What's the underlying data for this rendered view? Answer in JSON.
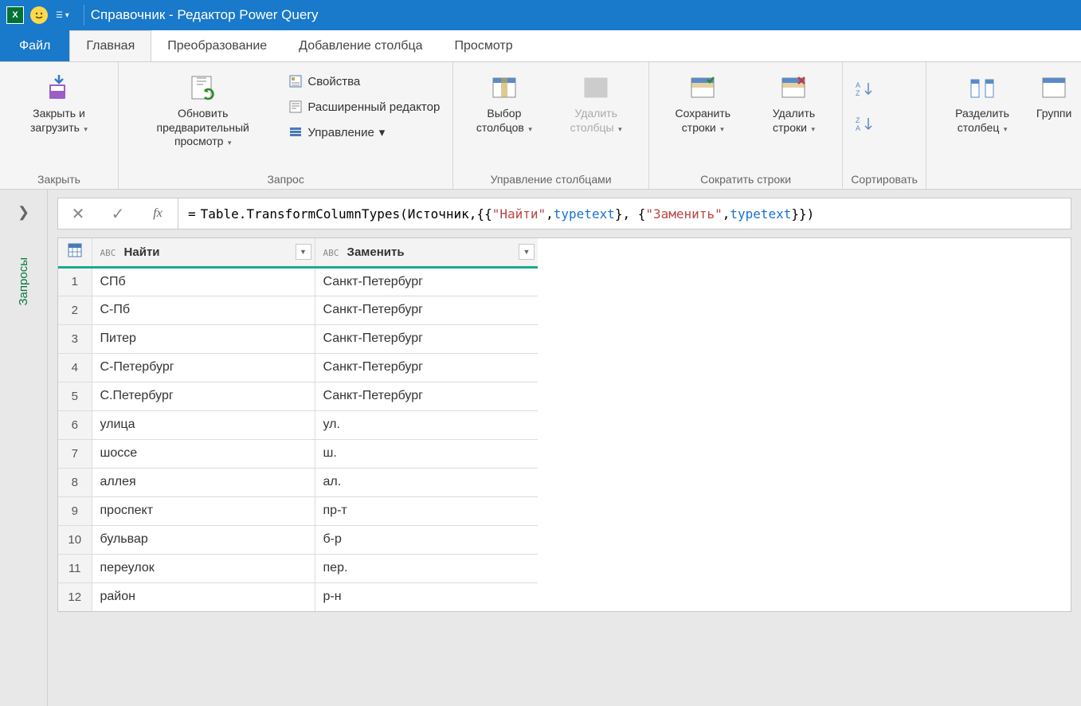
{
  "titlebar": {
    "title": "Справочник - Редактор Power Query"
  },
  "tabs": {
    "file": "Файл",
    "home": "Главная",
    "transform": "Преобразование",
    "addcolumn": "Добавление столбца",
    "view": "Просмотр"
  },
  "ribbon": {
    "close_group": "Закрыть",
    "close_load": "Закрыть и загрузить",
    "query_group": "Запрос",
    "refresh_preview": "Обновить предварительный просмотр",
    "properties": "Свойства",
    "adv_editor": "Расширенный редактор",
    "manage": "Управление",
    "manage_cols_group": "Управление столбцами",
    "choose_cols": "Выбор столбцов",
    "remove_cols": "Удалить столбцы",
    "reduce_rows_group": "Сократить строки",
    "keep_rows": "Сохранить строки",
    "remove_rows": "Удалить строки",
    "sort_group": "Сортировать",
    "split_col": "Разделить столбец",
    "group_by": "Группи"
  },
  "formula": {
    "prefix": "= ",
    "fn": "Table.TransformColumnTypes",
    "open": "(",
    "arg1": "Источник",
    "comma1": ",{{",
    "str1": "\"Найти\"",
    "comma2": ", ",
    "kw1": "type",
    "sp1": " ",
    "kw2": "text",
    "mid": "}, {",
    "str2": "\"Заменить\"",
    "comma3": ", ",
    "kw3": "type",
    "sp2": " ",
    "kw4": "text",
    "end": "}})"
  },
  "queries_label": "Запросы",
  "table": {
    "col1_type": "ABC",
    "col1_name": "Найти",
    "col2_type": "ABC",
    "col2_name": "Заменить",
    "rows": [
      {
        "n": "1",
        "a": "СПб",
        "b": "Санкт-Петербург"
      },
      {
        "n": "2",
        "a": "С-Пб",
        "b": "Санкт-Петербург"
      },
      {
        "n": "3",
        "a": "Питер",
        "b": "Санкт-Петербург"
      },
      {
        "n": "4",
        "a": "С-Петербург",
        "b": "Санкт-Петербург"
      },
      {
        "n": "5",
        "a": "С.Петербург",
        "b": "Санкт-Петербург"
      },
      {
        "n": "6",
        "a": "улица",
        "b": "ул."
      },
      {
        "n": "7",
        "a": "шоссе",
        "b": "ш."
      },
      {
        "n": "8",
        "a": "аллея",
        "b": "ал."
      },
      {
        "n": "9",
        "a": "проспект",
        "b": "пр-т"
      },
      {
        "n": "10",
        "a": "бульвар",
        "b": "б-р"
      },
      {
        "n": "11",
        "a": "переулок",
        "b": "пер."
      },
      {
        "n": "12",
        "a": "район",
        "b": "р-н"
      }
    ]
  }
}
